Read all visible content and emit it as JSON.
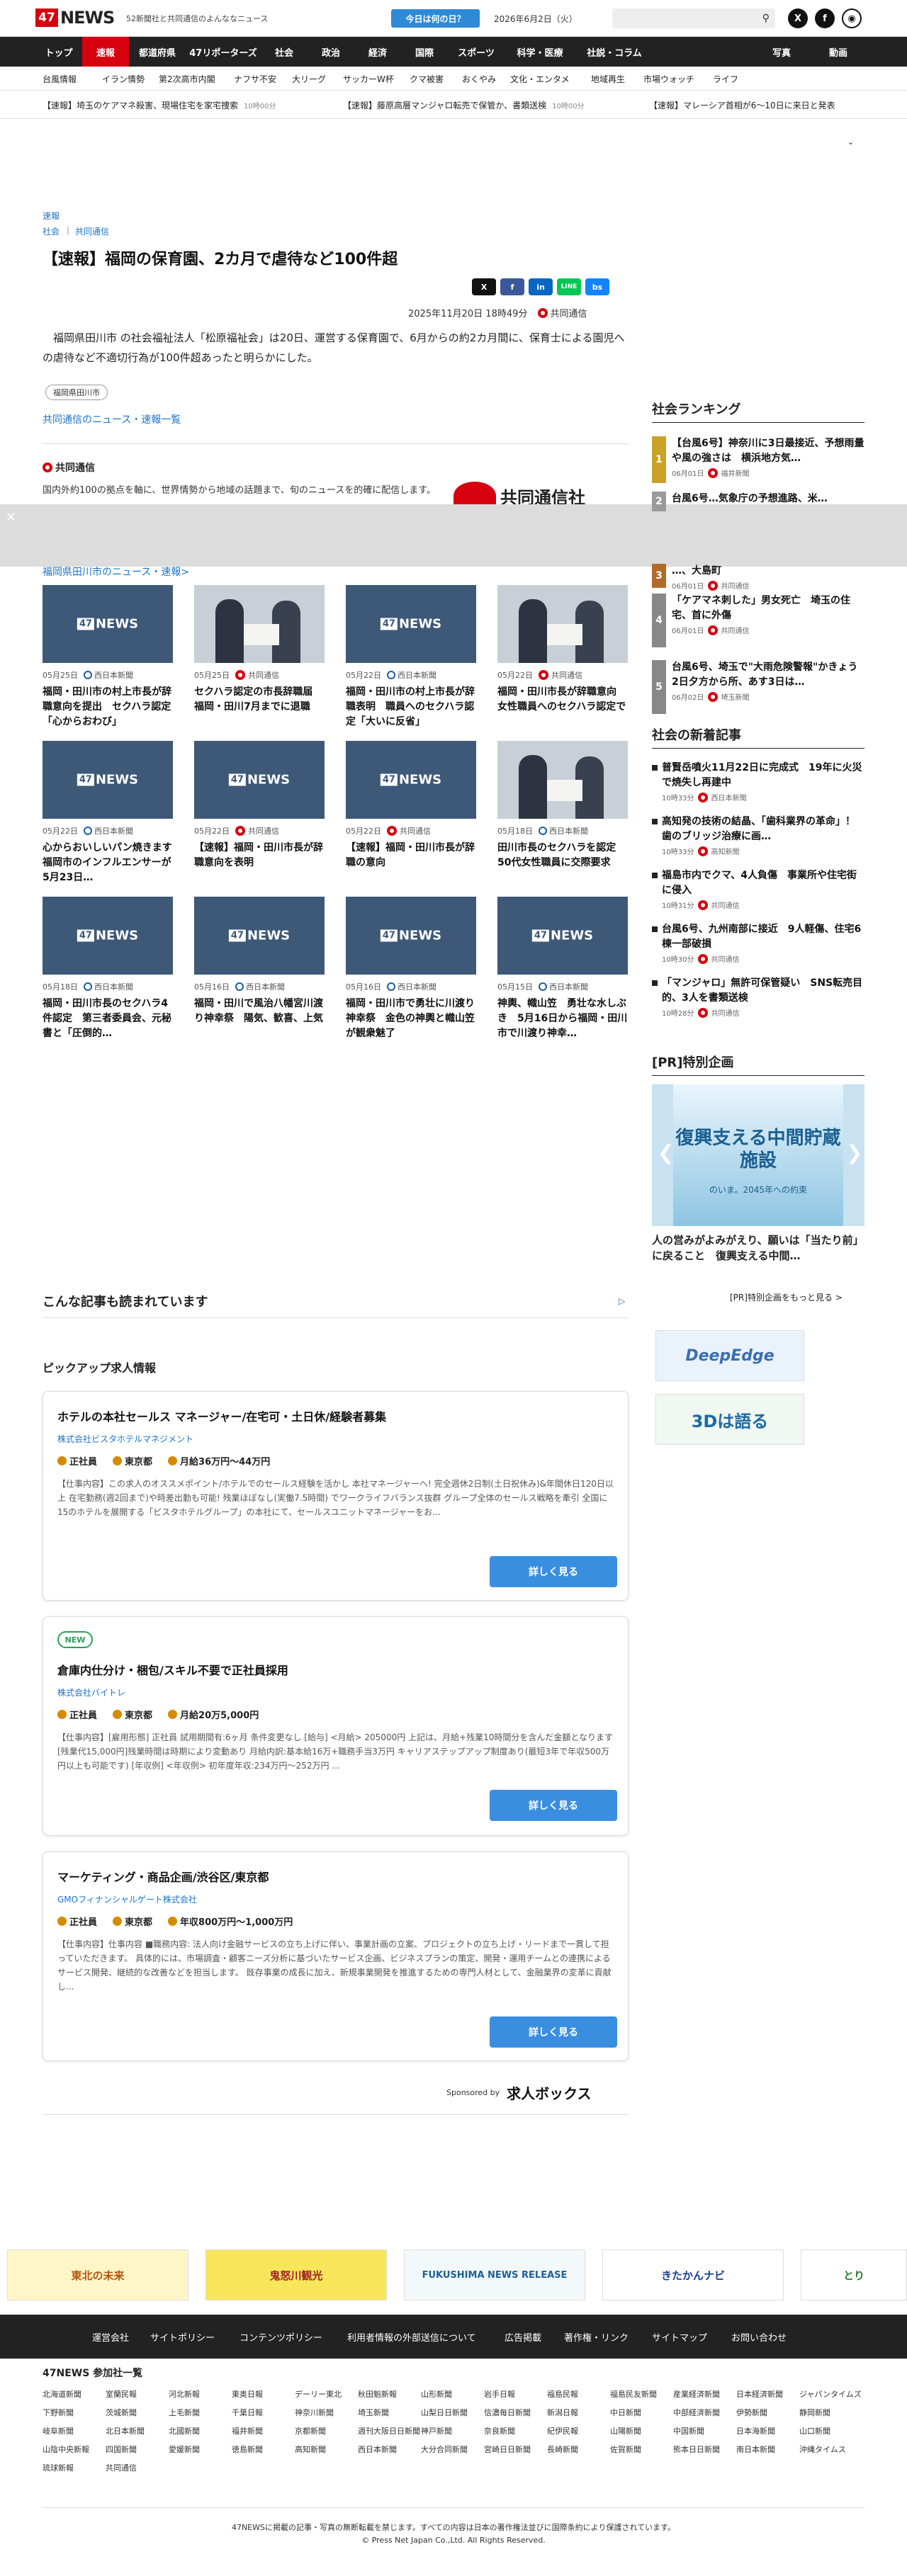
{
  "header": {
    "logo_box": "47",
    "logo_text": "NEWS",
    "tagline": "52新聞社と共同通信のよんななニュース",
    "today_button": "今日は何の日？",
    "date": "2026年6月2日（火）",
    "search_placeholder": ""
  },
  "nav": [
    "トップ",
    "速報",
    "都道府県",
    "47リポーターズ",
    "社会",
    "政治",
    "経済",
    "国際",
    "スポーツ",
    "科学・医療",
    "社説・コラム",
    "写真",
    "動画"
  ],
  "subnav": [
    "台風情報",
    "イラン情勢",
    "第2次高市内閣",
    "ナフサ不安",
    "大リーグ",
    "サッカーW杯",
    "クマ被害",
    "おくやみ",
    "文化・エンタメ",
    "地域再生",
    "市場ウォッチ",
    "ライフ"
  ],
  "ticker": [
    {
      "text": "【速報】埼玉のケアマネ殺害、現場住宅を家宅捜索",
      "time": "10時00分"
    },
    {
      "text": "【速報】藤原高層マンジャロ転売で保管か、書類送検",
      "time": "10時00分"
    },
    {
      "text": "【速報】マレーシア首相が6～10日に来日と発表",
      "time": ""
    }
  ],
  "article": {
    "crumb1": "速報",
    "crumb2": "社会",
    "crumb3": "共同通信",
    "title": "【速報】福岡の保育園、2カ月で虐待など100件超",
    "date": "2025年11月20日 18時49分",
    "source": "共同通信",
    "lead": "福岡県田川市 の社会福祉法人「松原福祉会」は20日、運営する保育園で、6月からの約2カ月間に、保育士による園児への虐待など不適切行為が100件超あったと明らかにした。",
    "tag": "福岡県田川市",
    "more_link": "共同通信のニュース・速報一覧",
    "kyodo_label": "共同通信",
    "kyodo_desc": "国内外約100の拠点を軸に、世界情勢から地域の話題まで、旬のニュースを的確に配信します。",
    "kyodo_logo": "共同通信社"
  },
  "share": [
    "X",
    "f",
    "in",
    "LINE",
    "bs"
  ],
  "related": {
    "link": "福岡県田川市のニュース・速報>",
    "cards": [
      {
        "date": "05月25日",
        "src": "西日本新聞",
        "title": "福岡・田川市の村上市長が辞職意向を提出　セクハラ認定「心からおわび」",
        "photo": false
      },
      {
        "date": "05月25日",
        "src": "共同通信",
        "title": "セクハラ認定の市長辞職届　福岡・田川7月までに退職",
        "photo": true
      },
      {
        "date": "05月22日",
        "src": "西日本新聞",
        "title": "福岡・田川市の村上市長が辞職表明　職員へのセクハラ認定「大いに反省」",
        "photo": false
      },
      {
        "date": "05月22日",
        "src": "共同通信",
        "title": "福岡・田川市長が辞職意向　女性職員へのセクハラ認定で",
        "photo": true
      },
      {
        "date": "05月22日",
        "src": "西日本新聞",
        "title": "心からおいしいパン焼きます　福岡市のインフルエンサーが5月23日…",
        "photo": false
      },
      {
        "date": "05月22日",
        "src": "共同通信",
        "title": "【速報】福岡・田川市長が辞職意向を表明",
        "photo": false
      },
      {
        "date": "05月22日",
        "src": "共同通信",
        "title": "【速報】福岡・田川市長が辞職の意向",
        "photo": false
      },
      {
        "date": "05月18日",
        "src": "西日本新聞",
        "title": "田川市長のセクハラを認定　50代女性職員に交際要求",
        "photo": true
      },
      {
        "date": "05月18日",
        "src": "西日本新聞",
        "title": "福岡・田川市長のセクハラ4件認定　第三者委員会、元秘書と「圧倒的…",
        "photo": false
      },
      {
        "date": "05月16日",
        "src": "西日本新聞",
        "title": "福岡・田川で風治八幡宮川渡り神幸祭　陽気、歓喜、上気",
        "photo": false
      },
      {
        "date": "05月16日",
        "src": "西日本新聞",
        "title": "福岡・田川市で勇壮に川渡り神幸祭　金色の神輿と幟山笠が観衆魅了",
        "photo": false
      },
      {
        "date": "05月15日",
        "src": "西日本新聞",
        "title": "神輿、幟山笠　勇壮な水しぶき　5月16日から福岡・田川市で川渡り神幸…",
        "photo": false
      }
    ],
    "logo_box": "47",
    "logo_text": "NEWS"
  },
  "ranking": {
    "title": "社会ランキング",
    "items": [
      {
        "n": "1",
        "title": "【台風6号】神奈川に3日最接近、予想雨量や風の強さは　横浜地方気…",
        "date": "06月01日",
        "src": "福井新聞"
      },
      {
        "n": "2",
        "title": "台風6号…気象庁の予想進路、米…",
        "date": "",
        "src": ""
      },
      {
        "n": "3",
        "title": "…、大島町",
        "date": "06月01日",
        "src": "共同通信"
      },
      {
        "n": "4",
        "title": "「ケアマネ刺した」男女死亡　埼玉の住宅、首に外傷",
        "date": "06月01日",
        "src": "共同通信"
      },
      {
        "n": "5",
        "title": "台風6号、埼玉で\"大雨危険警報\"かきょう2日夕方から所、あす3日は…",
        "date": "06月02日",
        "src": "埼玉新聞"
      }
    ]
  },
  "news": {
    "title": "社会の新着記事",
    "items": [
      {
        "title": "普賢岳噴火11月22日に完成式　19年に火災で焼失し再建中",
        "date": "10時33分",
        "src": "西日本新聞"
      },
      {
        "title": "高知発の技術の結晶、「歯科業界の革命」！　歯のブリッジ治療に画…",
        "date": "10時33分",
        "src": "高知新聞"
      },
      {
        "title": "福島市内でクマ、4人負傷　事業所や住宅街に侵入",
        "date": "10時31分",
        "src": "共同通信"
      },
      {
        "title": "台風6号、九州南部に接近　9人軽傷、住宅6棟一部破損",
        "date": "10時30分",
        "src": "共同通信"
      },
      {
        "title": "「マンジャロ」無許可保管疑い　SNS転売目的、3人を書類送検",
        "date": "10時28分",
        "src": "共同通信"
      }
    ]
  },
  "pr": {
    "title": "[PR]特別企画",
    "banner_head": "復興支える中間貯蔵施設",
    "banner_sub": "のいま。2045年への約束",
    "caption": "人の営みがよみがえり、願いは「当たり前」に戻ること　復興支える中間…",
    "more": "[PR]特別企画をもっと見る >",
    "side_banner1": "DeepEdge",
    "side_banner2": "3Dは語る"
  },
  "also_read": "こんな記事も読まれています",
  "jobs": {
    "title": "ピックアップ求人情報",
    "items": [
      {
        "title": "ホテルの本社セールス マネージャー/在宅可・土日休/経験者募集",
        "company": "株式会社ビスタホテルマネジメント",
        "type": "正社員",
        "place": "東京都",
        "salary": "月給36万円〜44万円",
        "desc": "【仕事内容】この求人のオススメポイント/ホテルでのセールス経験を活かし 本社マネージャーへ! 完全週休2日制(土日祝休み)&年間休日120日以上 在宅勤務(週2回まで)や時差出勤も可能! 残業ほぼなし(実働7.5時間) でワークライフバランス抜群 グループ全体のセールス戦略を牽引 全国に15のホテルを展開する「ビスタホテルグループ」の本社にて、セールスユニットマネージャーをお...",
        "is_new": false,
        "button": "詳しく見る"
      },
      {
        "title": "倉庫内仕分け・梱包/スキル不要で正社員採用",
        "company": "株式会社バイトレ",
        "type": "正社員",
        "place": "東京都",
        "salary": "月給20万5,000円",
        "desc": "【仕事内容】[雇用形態] 正社員 試用期間有:6ヶ月 条件変更なし [給与] <月給> 205000円 上記は、月給+残業10時間分を含んだ金額となります[残業代15,000円]残業時間は時期により変動あり 月給内訳:基本給16万+職務手当3万円 キャリアステップアップ制度あり(最短3年で年収500万円以上も可能です) [年収例] <年収例> 初年度年収:234万円〜252万円 ...",
        "is_new": true,
        "new_label": "NEW",
        "button": "詳しく見る"
      },
      {
        "title": "マーケティング・商品企画/渋谷区/東京都",
        "company": "GMOフィナンシャルゲート株式会社",
        "type": "正社員",
        "place": "東京都",
        "salary": "年収800万円〜1,000万円",
        "desc": "【仕事内容】仕事内容 ■職務内容: 法人向け金融サービスの立ち上げに伴い、事業計画の立案、プロジェクトの立ち上げ・リードまで一貫して担っていただきます。 具体的には、市場調査・顧客ニーズ分析に基づいたサービス企画、ビジネスプランの策定、開発・運用チームとの連携によるサービス開発、継続的な改善などを担当します。 既存事業の成長に加え、新規事業開発を推進するための専門人材として、金融業界の変革に貢献し...",
        "is_new": false,
        "button": "詳しく見る"
      }
    ],
    "sponsored": "Sponsored by",
    "sponsor_name": "求人ボックス"
  },
  "bottom_banners": [
    "東北の未来",
    "鬼怒川観光",
    "FUKUSHIMA NEWS RELEASE",
    "きたかんナビ",
    "とり"
  ],
  "footer": {
    "links": [
      "運営会社",
      "サイトポリシー",
      "コンテンツポリシー",
      "利用者情報の外部送信について",
      "広告掲載",
      "著作権・リンク",
      "サイトマップ",
      "お問い合わせ"
    ],
    "member_title": "47NEWS 参加社一覧",
    "members": [
      "北海道新聞",
      "室蘭民報",
      "河北新報",
      "東奥日報",
      "デーリー東北",
      "秋田魁新報",
      "山形新聞",
      "岩手日報",
      "福島民報",
      "福島民友新聞",
      "産業経済新聞",
      "日本経済新聞",
      "ジャパンタイムズ",
      "下野新聞",
      "茨城新聞",
      "上毛新聞",
      "千葉日報",
      "神奈川新聞",
      "埼玉新聞",
      "山梨日日新聞",
      "信濃毎日新聞",
      "新潟日報",
      "中日新聞",
      "中部経済新聞",
      "伊勢新聞",
      "静岡新聞",
      "岐阜新聞",
      "北日本新聞",
      "北國新聞",
      "福井新聞",
      "京都新聞",
      "週刊大阪日日新聞",
      "神戸新聞",
      "奈良新聞",
      "紀伊民報",
      "山陽新聞",
      "中国新聞",
      "日本海新聞",
      "山口新聞",
      "山陰中央新報",
      "四国新聞",
      "愛媛新聞",
      "徳島新聞",
      "高知新聞",
      "西日本新聞",
      "大分合同新聞",
      "宮崎日日新聞",
      "長崎新聞",
      "佐賀新聞",
      "熊本日日新聞",
      "南日本新聞",
      "沖縄タイムス",
      "琉球新報",
      "共同通信"
    ],
    "note": "47NEWSに掲載の記事・写真の無断転載を禁じます。すべての内容は日本の著作権法並びに国際条約により保護されています。",
    "copyright": "© Press Net Japan Co.,Ltd. All Rights Reserved."
  }
}
